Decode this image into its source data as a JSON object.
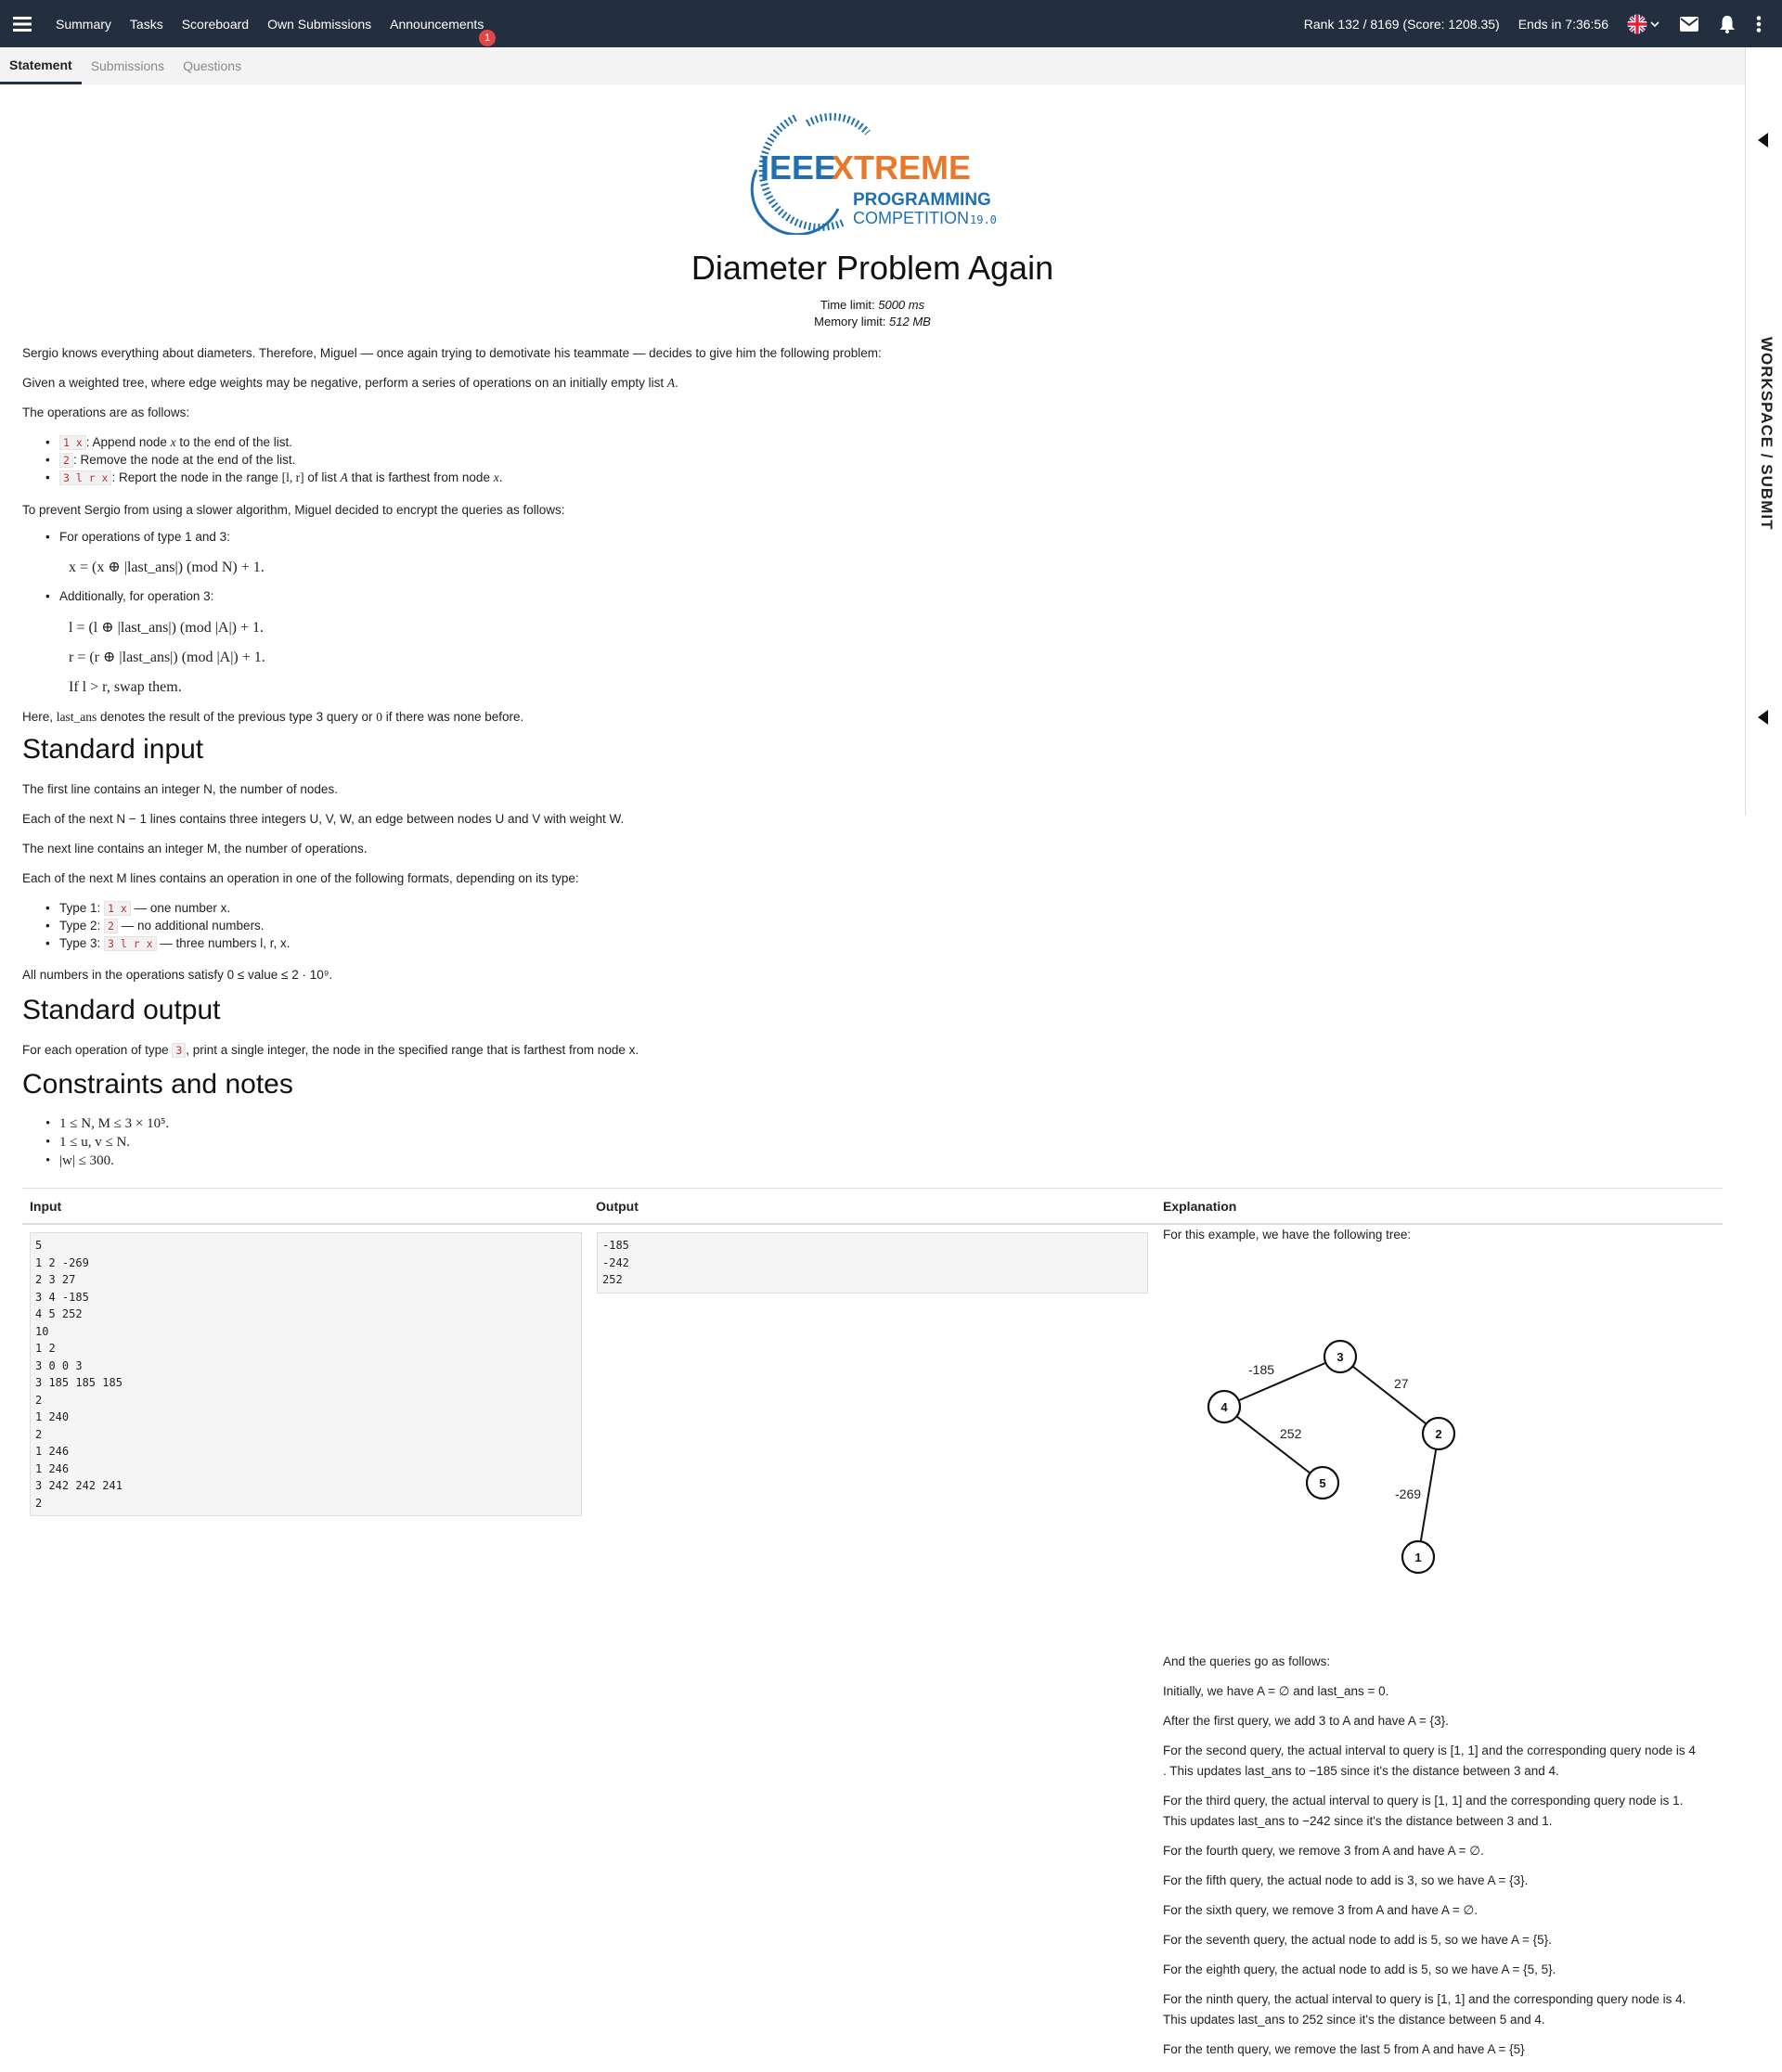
{
  "topbar": {
    "nav": [
      "Summary",
      "Tasks",
      "Scoreboard",
      "Own Submissions",
      "Announcements"
    ],
    "announcement_badge": "1",
    "rank": "Rank 132 / 8169 (Score: 1208.35)",
    "ends": "Ends in 7:36:56",
    "icons": [
      "menu-icon",
      "uk-flag-icon",
      "mail-icon",
      "bell-icon",
      "more-vertical-icon"
    ]
  },
  "tabs": [
    "Statement",
    "Submissions",
    "Questions"
  ],
  "sidebar": {
    "label": "WORKSPACE / SUBMIT"
  },
  "logo": {
    "line1a": "IEEE",
    "line1b": "XTREME",
    "line2": "PROGRAMMING",
    "line3": "COMPETITION",
    "version": "19.0"
  },
  "problem": {
    "title": "Diameter Problem Again",
    "time_label": "Time limit: ",
    "time_value": "5000 ms",
    "mem_label": "Memory limit: ",
    "mem_value": "512 MB"
  },
  "statement": {
    "p1": "Sergio knows everything about diameters. Therefore, Miguel — once again trying to demotivate his teammate — decides to give him the following problem:",
    "p2a": "Given a weighted tree, where edge weights may be negative, perform a series of operations on an initially empty list ",
    "p2b": "A",
    "p3": "The operations are as follows:",
    "op1_code": "1 x",
    "op1_a": ": Append node ",
    "op1_b": "x",
    "op1_c": " to the end of the list.",
    "op2_code": "2",
    "op2_text": ": Remove the node at the end of the list.",
    "op3_code": "3 l r x",
    "op3_a": ": Report the node in the range ",
    "op3_b": "[l, r]",
    "op3_c": " of list ",
    "op3_d": "A",
    "op3_e": " that is farthest from node ",
    "op3_f": "x",
    "p4": "To prevent Sergio from using a slower algorithm, Miguel decided to encrypt the queries as follows:",
    "enc1": "For operations of type 1 and 3:",
    "f1": "x = (x ⊕ |last_ans|)  (mod N) + 1.",
    "enc2": "Additionally, for operation 3:",
    "f2": "l = (l ⊕ |last_ans|)  (mod |A|) + 1.",
    "f3": "r = (r ⊕ |last_ans|)  (mod |A|) + 1.",
    "f4": "If l > r, swap them.",
    "p5a": "Here, ",
    "p5b": "last_ans",
    "p5c": " denotes the result of the previous type 3 query or ",
    "p5d": "0",
    "p5e": " if there was none before."
  },
  "input_section": {
    "heading": "Standard input",
    "l1": "The first line contains an integer N, the number of nodes.",
    "l2": "Each of the next N − 1 lines contains three integers U, V, W, an edge between nodes U and V with weight W.",
    "l3": "The next line contains an integer M, the number of operations.",
    "l4": "Each of the next M lines contains an operation in one of the following formats, depending on its type:",
    "t1a": "Type 1: ",
    "t1code": "1 x",
    "t1b": " — one number x.",
    "t2a": "Type 2: ",
    "t2code": "2",
    "t2b": " — no additional numbers.",
    "t3a": "Type 3: ",
    "t3code": "3 l r x",
    "t3b": " — three numbers l, r, x.",
    "l5": "All numbers in the operations satisfy 0 ≤ value ≤ 2 · 10⁹."
  },
  "output_section": {
    "heading": "Standard output",
    "l1a": "For each operation of type ",
    "l1code": "3",
    "l1b": ", print a single integer, the node in the specified range that is farthest from node x."
  },
  "constraints": {
    "heading": "Constraints and notes",
    "items": [
      "1 ≤ N, M ≤ 3 × 10⁵.",
      "1 ≤ u, v ≤ N.",
      "|w| ≤ 300."
    ]
  },
  "example": {
    "headers": [
      "Input",
      "Output",
      "Explanation"
    ],
    "input": "5\n1 2 -269\n2 3 27\n3 4 -185\n4 5 252\n10\n1 2\n3 0 0 3\n3 185 185 185\n2\n1 240\n2\n1 246\n1 246\n3 242 242 241\n2",
    "output": "-185\n-242\n252"
  },
  "explanation": {
    "intro": "For this example, we have the following tree:",
    "tree_nodes": [
      "1",
      "2",
      "3",
      "4",
      "5"
    ],
    "tree_edges": [
      {
        "u": "3",
        "v": "4",
        "w": "-185"
      },
      {
        "u": "3",
        "v": "2",
        "w": "27"
      },
      {
        "u": "4",
        "v": "5",
        "w": "252"
      },
      {
        "u": "2",
        "v": "1",
        "w": "-269"
      }
    ],
    "lines": [
      "And the queries go as follows:",
      "Initially, we have A = ∅ and last_ans = 0.",
      "After the first query, we add 3 to A and have A = {3}.",
      "For the second query, the actual interval to query is [1, 1] and the corresponding query node is 4",
      ". This updates last_ans to −185 since it's the distance between 3 and 4.",
      "For the third query, the actual interval to query is [1, 1] and the corresponding query node is 1.",
      "This updates last_ans to −242 since it's the distance between 3 and 1.",
      "For the fourth query, we remove 3 from A and have A = ∅.",
      "For the fifth query, the actual node to add is 3, so we have A = {3}.",
      "For the sixth query, we remove 3 from A and have A = ∅.",
      "For the seventh query, the actual node to add is 5, so we have A = {5}.",
      "For the eighth query, the actual node to add is 5, so we have A = {5, 5}.",
      "For the ninth query, the actual interval to query is [1, 1] and the corresponding query node is 4.",
      "This updates last_ans to 252 since it's the distance between 5 and 4.",
      "For the tenth query, we remove the last 5 from A and have A = {5}"
    ]
  },
  "colors": {
    "topbar": "#232f3e",
    "logo_orange": "#e8792b",
    "logo_blue": "#1f6fb2",
    "badge": "#e04848"
  }
}
